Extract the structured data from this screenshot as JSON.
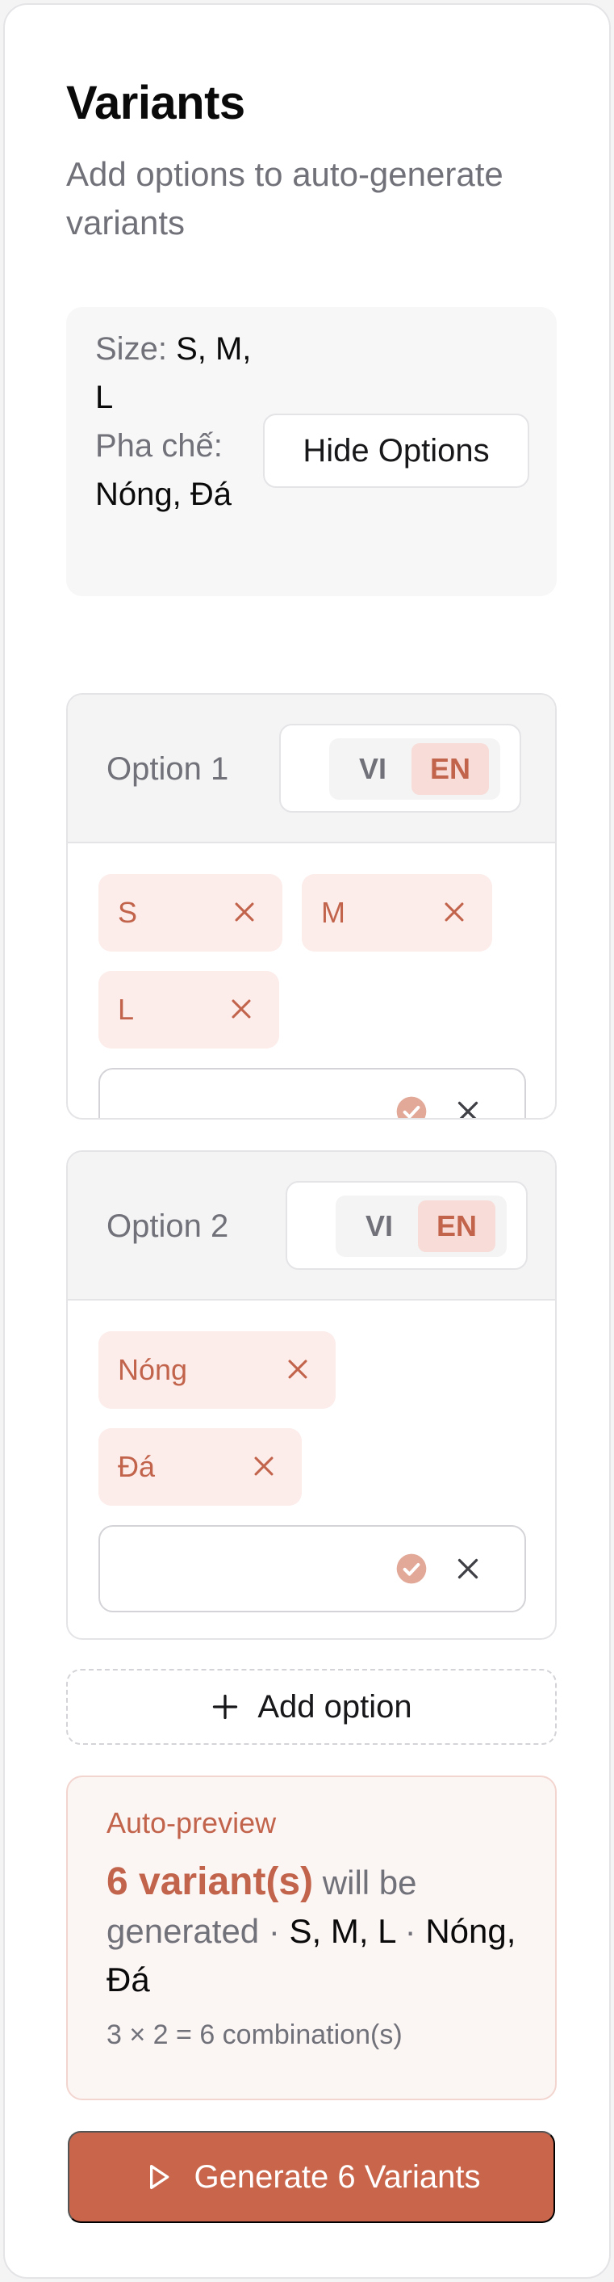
{
  "panel": {
    "title": "Variants",
    "subtitle": "Add options to auto-generate variants"
  },
  "summary": {
    "size_key": "Size:",
    "size_values": "S, M, L",
    "phache_key": "Pha chế:",
    "phache_values": "Nóng, Đá",
    "hide_button": "Hide Options"
  },
  "options": [
    {
      "label": "Option 1",
      "lang_vi": "VI",
      "lang_en": "EN",
      "active_lang": "EN",
      "chips": [
        "S",
        "M",
        "L"
      ]
    },
    {
      "label": "Option 2",
      "lang_vi": "VI",
      "lang_en": "EN",
      "active_lang": "EN",
      "chips": [
        "Nóng",
        "Đá"
      ]
    }
  ],
  "add_option": "Add option",
  "preview": {
    "label": "Auto-preview",
    "count": "6 variant(s)",
    "will_be": "will be generated ·",
    "sizes": "S, M, L",
    "sep": "·",
    "phache": "Nóng, Đá",
    "calc": "3 × 2 = 6 combination(s)"
  },
  "generate_button": "Generate 6 Variants",
  "colors": {
    "accent": "#c8654b",
    "chip_bg": "#fcecea",
    "chip_text": "#c2644c"
  }
}
